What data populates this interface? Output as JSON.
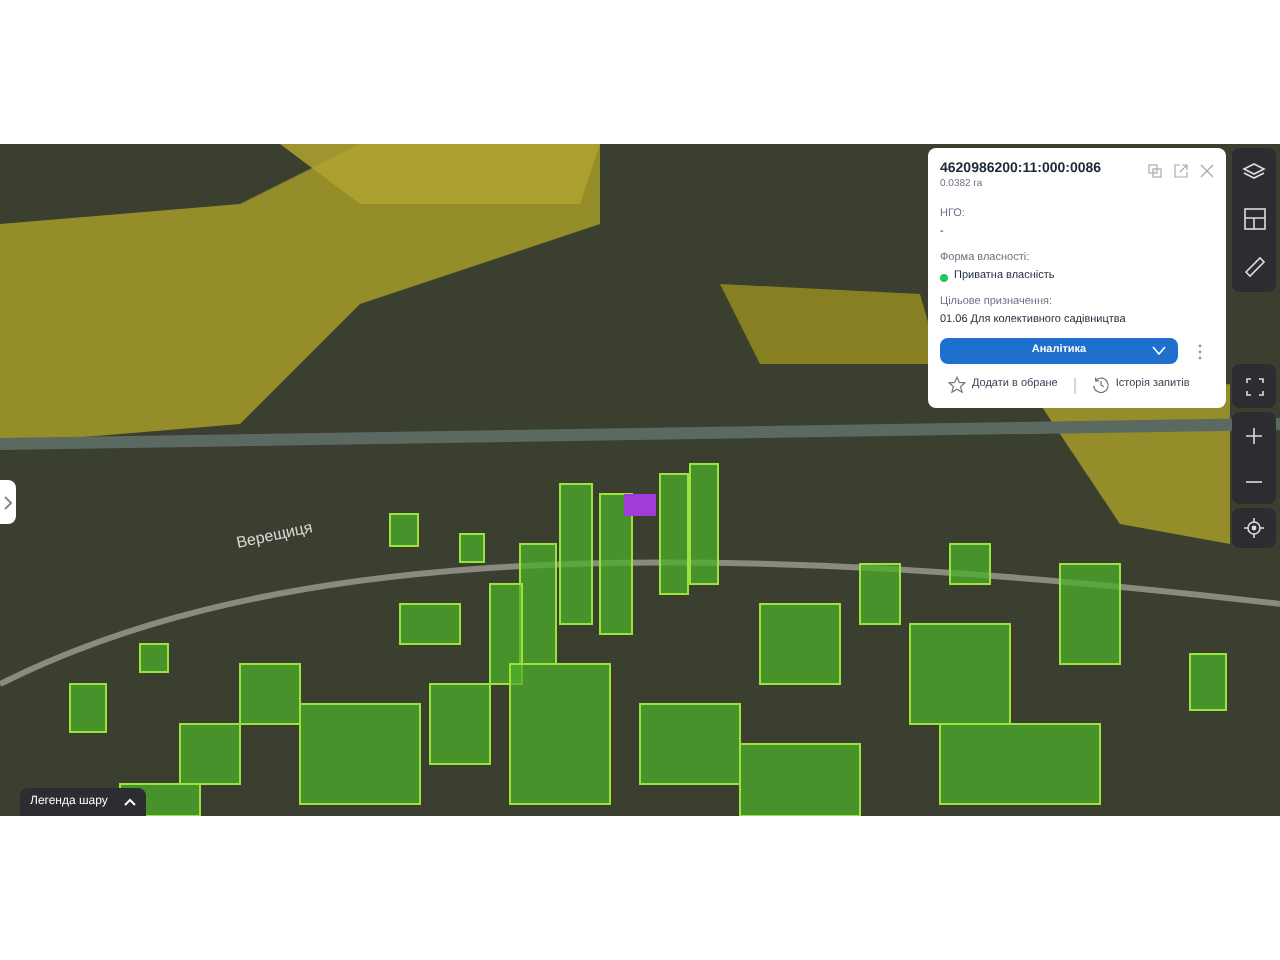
{
  "map": {
    "place_label": "Верещиця"
  },
  "parcel_card": {
    "cadastral_number": "4620986200:11:000:0086",
    "area": "0.0382 га",
    "fields": [
      {
        "label": "НГО:",
        "value": "-"
      },
      {
        "label": "Форма власності:",
        "value": "Приватна власність",
        "color": "#22c55e"
      },
      {
        "label": "Цільове призначення:",
        "value": "01.06 Для колективного садівництва"
      }
    ],
    "analytics_button": "Аналітика",
    "add_favorite": "Додати в обране",
    "history": "Історія запитів"
  },
  "legend_button": "Легенда шару"
}
